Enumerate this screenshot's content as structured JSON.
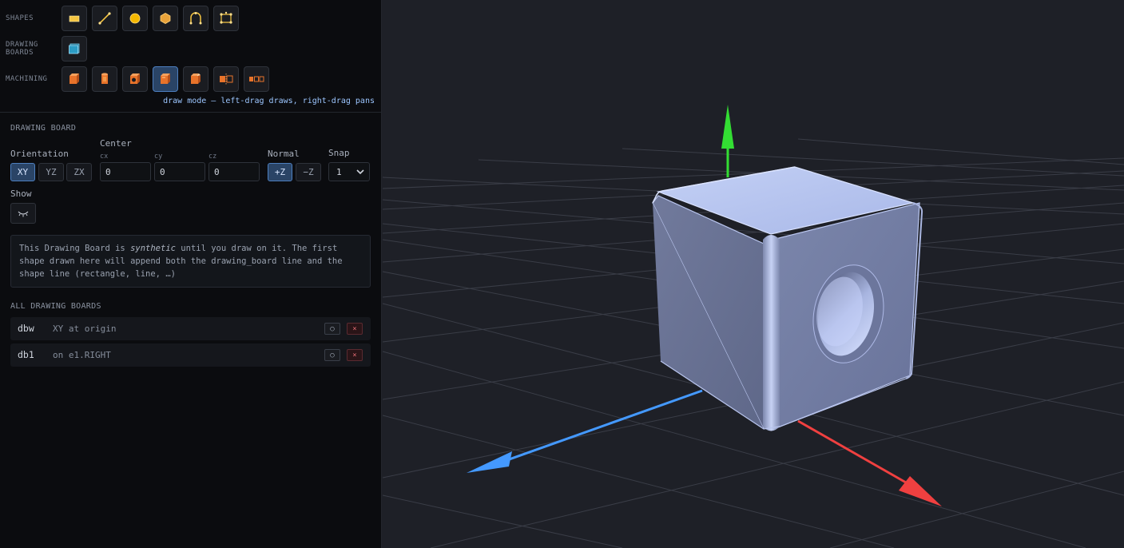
{
  "toolbar": {
    "rows": [
      {
        "label": "SHAPES",
        "tools": [
          "rectangle-icon",
          "line-icon",
          "circle-icon",
          "polygon-icon",
          "arc-icon",
          "spline-icon"
        ]
      },
      {
        "label": "DRAWING\nBOARDS",
        "tools": [
          "drawing-board-icon"
        ]
      },
      {
        "label": "MACHINING",
        "tools": [
          "extrude-icon",
          "cylinder-icon",
          "hole-icon",
          "pocket-icon",
          "chamfer-icon",
          "split-icon",
          "pattern-icon"
        ]
      }
    ],
    "mode_hint": "draw mode — left-drag draws, right-drag pans"
  },
  "drawing_board": {
    "title": "DRAWING BOARD",
    "orientation_label": "Orientation",
    "orientation_options": [
      "XY",
      "YZ",
      "ZX"
    ],
    "orientation_selected": "XY",
    "center_label": "Center",
    "cx_label": "cx",
    "cy_label": "cy",
    "cz_label": "cz",
    "cx": "0",
    "cy": "0",
    "cz": "0",
    "normal_label": "Normal",
    "normal_options": [
      "+Z",
      "−Z"
    ],
    "normal_selected": "+Z",
    "snap_label": "Snap",
    "snap_value": "1",
    "show_label": "Show",
    "info_prefix": "This Drawing Board is ",
    "info_em": "synthetic",
    "info_suffix": " until you draw on it. The first shape drawn here will append both the drawing_board line and the shape line (rectangle, line, …)"
  },
  "all_boards": {
    "title": "ALL DRAWING BOARDS",
    "items": [
      {
        "id": "dbw",
        "desc": "XY at origin",
        "vis": "○",
        "del": "×"
      },
      {
        "id": "db1",
        "desc": "on e1.RIGHT",
        "vis": "○",
        "del": "×"
      }
    ]
  },
  "viewport": {
    "background": "#1e2027",
    "axis_colors": {
      "x": "#f04040",
      "y": "#33dd33",
      "z": "#4499ff"
    },
    "model_color": "#8f9ac4"
  }
}
